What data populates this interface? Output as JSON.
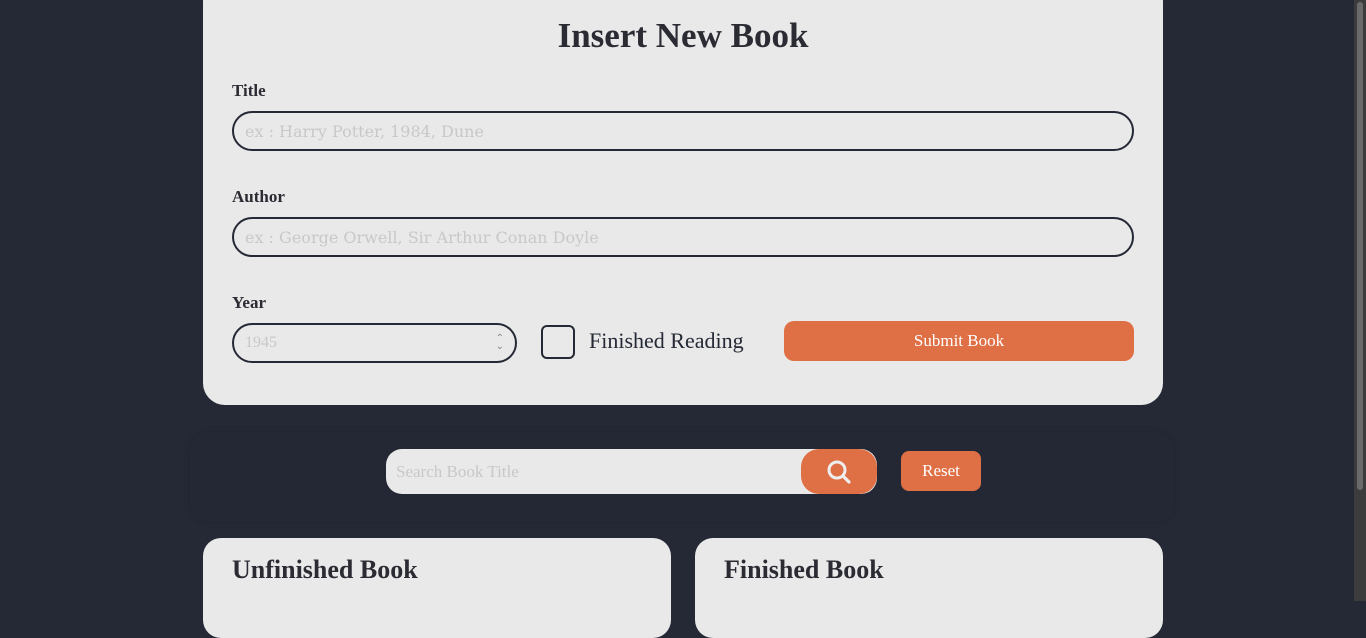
{
  "form": {
    "title": "Insert New Book",
    "title_label": "Title",
    "title_placeholder": "ex : Harry Potter, 1984, Dune",
    "title_value": "",
    "author_label": "Author",
    "author_placeholder": "ex : George Orwell, Sir Arthur Conan Doyle",
    "author_value": "",
    "year_label": "Year",
    "year_placeholder": "1945",
    "finished_label": "Finished Reading",
    "finished_checked": false,
    "submit_label": "Submit Book"
  },
  "search": {
    "placeholder": "Search Book Title",
    "value": "",
    "search_icon": "search-icon",
    "reset_label": "Reset"
  },
  "shelves": {
    "unfinished_title": "Unfinished Book",
    "finished_title": "Finished Book"
  },
  "colors": {
    "background": "#252936",
    "card": "#e9e9e9",
    "accent": "#df7045",
    "text": "#2b2b33"
  }
}
